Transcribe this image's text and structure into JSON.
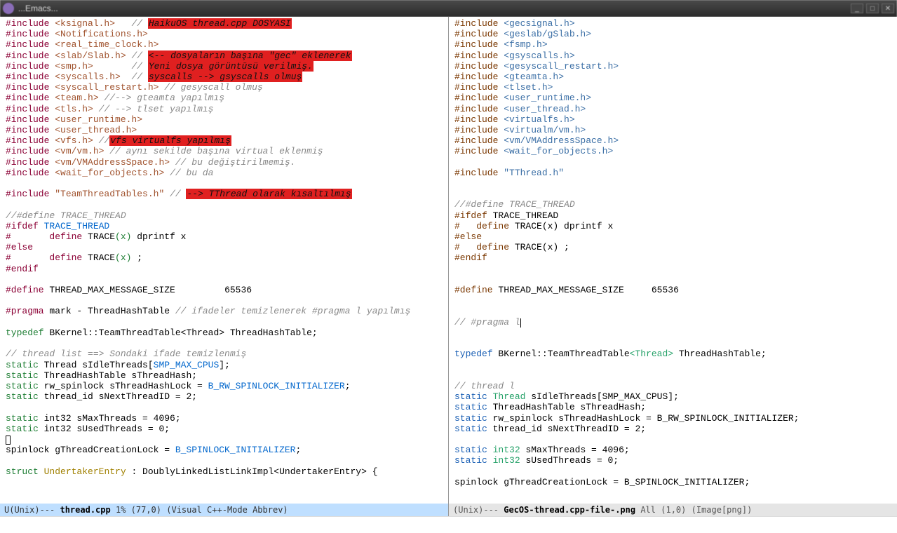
{
  "window": {
    "title": "...Emacs..."
  },
  "left": {
    "lines": [
      [
        [
          "kw-pp",
          "#include "
        ],
        [
          "kw-str",
          "<ksignal.h>"
        ],
        [
          "",
          "   "
        ],
        [
          "kw-cmt",
          "// "
        ],
        [
          "kw-hl",
          "HaikuOS thread.cpp DOSYASI"
        ]
      ],
      [
        [
          "kw-pp",
          "#include "
        ],
        [
          "kw-str",
          "<Notifications.h>"
        ]
      ],
      [
        [
          "kw-pp",
          "#include "
        ],
        [
          "kw-str",
          "<real_time_clock.h>"
        ]
      ],
      [
        [
          "kw-pp",
          "#include "
        ],
        [
          "kw-str",
          "<slab/Slab.h>"
        ],
        [
          "",
          " "
        ],
        [
          "kw-cmt",
          "// "
        ],
        [
          "kw-hl",
          "<-- dosyaların başına \"gec\" eklenerek"
        ]
      ],
      [
        [
          "kw-pp",
          "#include "
        ],
        [
          "kw-str",
          "<smp.h>"
        ],
        [
          "",
          "       "
        ],
        [
          "kw-cmt",
          "// "
        ],
        [
          "kw-hl",
          "Yeni dosya görüntüsü verilmiş."
        ]
      ],
      [
        [
          "kw-pp",
          "#include "
        ],
        [
          "kw-str",
          "<syscalls.h>"
        ],
        [
          "",
          "  "
        ],
        [
          "kw-cmt",
          "// "
        ],
        [
          "kw-hl",
          "syscalls --> gsyscalls olmuş"
        ]
      ],
      [
        [
          "kw-pp",
          "#include "
        ],
        [
          "kw-str",
          "<syscall_restart.h>"
        ],
        [
          "",
          " "
        ],
        [
          "kw-cmt",
          "// gesyscall olmuş"
        ]
      ],
      [
        [
          "kw-pp",
          "#include "
        ],
        [
          "kw-str",
          "<team.h>"
        ],
        [
          "",
          " "
        ],
        [
          "kw-cmt",
          "//--> gteamta yapılmış"
        ]
      ],
      [
        [
          "kw-pp",
          "#include "
        ],
        [
          "kw-str",
          "<tls.h>"
        ],
        [
          "",
          " "
        ],
        [
          "kw-cmt",
          "// --> tlset yapılmış"
        ]
      ],
      [
        [
          "kw-pp",
          "#include "
        ],
        [
          "kw-str",
          "<user_runtime.h>"
        ]
      ],
      [
        [
          "kw-pp",
          "#include "
        ],
        [
          "kw-str",
          "<user_thread.h>"
        ]
      ],
      [
        [
          "kw-pp",
          "#include "
        ],
        [
          "kw-str",
          "<vfs.h>"
        ],
        [
          "",
          " "
        ],
        [
          "kw-cmt",
          "//"
        ],
        [
          "kw-hl",
          "vfs virtualfs yapılmış"
        ]
      ],
      [
        [
          "kw-pp",
          "#include "
        ],
        [
          "kw-str",
          "<vm/vm.h>"
        ],
        [
          "",
          " "
        ],
        [
          "kw-cmt",
          "// aynı sekilde başına virtual eklenmiş"
        ]
      ],
      [
        [
          "kw-pp",
          "#include "
        ],
        [
          "kw-str",
          "<vm/VMAddressSpace.h>"
        ],
        [
          "",
          " "
        ],
        [
          "kw-cmt",
          "// bu değiştirilmemiş."
        ]
      ],
      [
        [
          "kw-pp",
          "#include "
        ],
        [
          "kw-str",
          "<wait_for_objects.h>"
        ],
        [
          "",
          " "
        ],
        [
          "kw-cmt",
          "// bu da"
        ]
      ],
      [
        [
          "",
          ""
        ]
      ],
      [
        [
          "kw-pp",
          "#include "
        ],
        [
          "kw-str",
          "\"TeamThreadTables.h\""
        ],
        [
          "",
          " "
        ],
        [
          "kw-cmt",
          "// "
        ],
        [
          "kw-hl",
          "--> TThread olarak kısaltılmış"
        ]
      ],
      [
        [
          "",
          ""
        ]
      ],
      [
        [
          "kw-cmt",
          "//#define TRACE_THREAD"
        ]
      ],
      [
        [
          "kw-pp",
          "#ifdef "
        ],
        [
          "kw-const",
          "TRACE_THREAD"
        ]
      ],
      [
        [
          "kw-pp",
          "#"
        ],
        [
          "",
          "       "
        ],
        [
          "kw-pp",
          "define "
        ],
        [
          "",
          "TRACE"
        ],
        [
          "kw-type",
          "(x)"
        ],
        [
          "",
          " dprintf x"
        ]
      ],
      [
        [
          "kw-pp",
          "#else"
        ]
      ],
      [
        [
          "kw-pp",
          "#"
        ],
        [
          "",
          "       "
        ],
        [
          "kw-pp",
          "define "
        ],
        [
          "",
          "TRACE"
        ],
        [
          "kw-type",
          "(x)"
        ],
        [
          "",
          " ;"
        ]
      ],
      [
        [
          "kw-pp",
          "#endif"
        ]
      ],
      [
        [
          "",
          ""
        ]
      ],
      [
        [
          "kw-pp",
          "#define "
        ],
        [
          "",
          "THREAD_MAX_MESSAGE_SIZE         65536"
        ]
      ],
      [
        [
          "",
          ""
        ]
      ],
      [
        [
          "kw-pp",
          "#pragma "
        ],
        [
          "",
          "mark - ThreadHashTable "
        ],
        [
          "kw-cmt",
          "// ifadeler temizlenerek #pragma l yapılmış"
        ]
      ],
      [
        [
          "",
          ""
        ]
      ],
      [
        [
          "kw-type",
          "typedef"
        ],
        [
          "",
          " BKernel::TeamThreadTable<Thread> ThreadHashTable;"
        ]
      ],
      [
        [
          "",
          ""
        ]
      ],
      [
        [
          "kw-cmt",
          "// thread list ==> Sondaki ifade temizlenmiş"
        ]
      ],
      [
        [
          "kw-type",
          "static"
        ],
        [
          "",
          " Thread sIdleThreads["
        ],
        [
          "kw-const",
          "SMP_MAX_CPUS"
        ],
        [
          "",
          "];"
        ]
      ],
      [
        [
          "kw-type",
          "static"
        ],
        [
          "",
          " ThreadHashTable sThreadHash;"
        ]
      ],
      [
        [
          "kw-type",
          "static"
        ],
        [
          "",
          " rw_spinlock sThreadHashLock = "
        ],
        [
          "kw-const",
          "B_RW_SPINLOCK_INITIALIZER"
        ],
        [
          "",
          ";"
        ]
      ],
      [
        [
          "kw-type",
          "static"
        ],
        [
          "",
          " thread_id sNextThreadID = 2;"
        ]
      ],
      [
        [
          "",
          ""
        ]
      ],
      [
        [
          "kw-type",
          "static"
        ],
        [
          "",
          " int32 sMaxThreads = 4096;"
        ]
      ],
      [
        [
          "kw-type",
          "static"
        ],
        [
          "",
          " int32 sUsedThreads = 0;"
        ]
      ],
      [
        [
          "box",
          "[]"
        ]
      ],
      [
        [
          "",
          "spinlock gThreadCreationLock = "
        ],
        [
          "kw-const",
          "B_SPINLOCK_INITIALIZER"
        ],
        [
          "",
          ";"
        ]
      ],
      [
        [
          "",
          ""
        ]
      ],
      [
        [
          "kw-type",
          "struct"
        ],
        [
          "",
          " "
        ],
        [
          "kw-ident",
          "UndertakerEntry"
        ],
        [
          "",
          " : DoublyLinkedListLinkImpl<UndertakerEntry> {"
        ]
      ]
    ],
    "modeline": {
      "prefix": "U(Unix)---  ",
      "buffer": "thread.cpp",
      "pos": "1%",
      "coords": "(77,0)",
      "mode": "(Visual C++-Mode Abbrev)"
    }
  },
  "right": {
    "lines": [
      [
        [
          "kw-pp",
          "#include "
        ],
        [
          "kw-str",
          "<gecsignal.h>"
        ]
      ],
      [
        [
          "kw-pp",
          "#include "
        ],
        [
          "kw-str",
          "<geslab/gSlab.h>"
        ]
      ],
      [
        [
          "kw-pp",
          "#include "
        ],
        [
          "kw-str",
          "<fsmp.h>"
        ]
      ],
      [
        [
          "kw-pp",
          "#include "
        ],
        [
          "kw-str",
          "<gsyscalls.h>"
        ]
      ],
      [
        [
          "kw-pp",
          "#include "
        ],
        [
          "kw-str",
          "<gesyscall_restart.h>"
        ]
      ],
      [
        [
          "kw-pp",
          "#include "
        ],
        [
          "kw-str",
          "<gteamta.h>"
        ]
      ],
      [
        [
          "kw-pp",
          "#include "
        ],
        [
          "kw-str",
          "<tlset.h>"
        ]
      ],
      [
        [
          "kw-pp",
          "#include "
        ],
        [
          "kw-str",
          "<user_runtime.h>"
        ]
      ],
      [
        [
          "kw-pp",
          "#include "
        ],
        [
          "kw-str",
          "<user_thread.h>"
        ]
      ],
      [
        [
          "kw-pp",
          "#include "
        ],
        [
          "kw-str",
          "<virtualfs.h>"
        ]
      ],
      [
        [
          "kw-pp",
          "#include "
        ],
        [
          "kw-str",
          "<virtualm/vm.h>"
        ]
      ],
      [
        [
          "kw-pp",
          "#include "
        ],
        [
          "kw-str",
          "<vm/VMAddressSpace.h>"
        ]
      ],
      [
        [
          "kw-pp",
          "#include "
        ],
        [
          "kw-str",
          "<wait_for_objects.h>"
        ]
      ],
      [
        [
          "",
          ""
        ]
      ],
      [
        [
          "kw-pp",
          "#include "
        ],
        [
          "kw-str",
          "\"TThread.h\""
        ]
      ],
      [
        [
          "",
          ""
        ]
      ],
      [
        [
          "",
          ""
        ]
      ],
      [
        [
          "kw-cmt",
          "//#define TRACE_THREAD"
        ]
      ],
      [
        [
          "kw-pp",
          "#ifdef "
        ],
        [
          "",
          "TRACE_THREAD"
        ]
      ],
      [
        [
          "kw-pp",
          "#   define "
        ],
        [
          "",
          "TRACE(x) dprintf x"
        ]
      ],
      [
        [
          "kw-pp",
          "#else"
        ]
      ],
      [
        [
          "kw-pp",
          "#   define "
        ],
        [
          "",
          "TRACE(x) ;"
        ]
      ],
      [
        [
          "kw-pp",
          "#endif"
        ]
      ],
      [
        [
          "",
          ""
        ]
      ],
      [
        [
          "",
          ""
        ]
      ],
      [
        [
          "kw-pp",
          "#define "
        ],
        [
          "",
          "THREAD_MAX_MESSAGE_SIZE     65536"
        ]
      ],
      [
        [
          "",
          ""
        ]
      ],
      [
        [
          "",
          ""
        ]
      ],
      [
        [
          "kw-cmt",
          "// #pragma l"
        ],
        [
          "cursor",
          ""
        ]
      ],
      [
        [
          "",
          ""
        ]
      ],
      [
        [
          "",
          ""
        ]
      ],
      [
        [
          "kw-type",
          "typedef"
        ],
        [
          "",
          " BKernel::TeamThreadTable"
        ],
        [
          "kw-ang",
          "<Thread>"
        ],
        [
          "",
          " ThreadHashTable;"
        ]
      ],
      [
        [
          "",
          ""
        ]
      ],
      [
        [
          "",
          ""
        ]
      ],
      [
        [
          "kw-cmt",
          "// thread l"
        ]
      ],
      [
        [
          "kw-type",
          "static"
        ],
        [
          "",
          " "
        ],
        [
          "kw-type2",
          "Thread"
        ],
        [
          "",
          " sIdleThreads[SMP_MAX_CPUS];"
        ]
      ],
      [
        [
          "kw-type",
          "static"
        ],
        [
          "",
          " ThreadHashTable sThreadHash;"
        ]
      ],
      [
        [
          "kw-type",
          "static"
        ],
        [
          "",
          " rw_spinlock sThreadHashLock = B_RW_SPINLOCK_INITIALIZER;"
        ]
      ],
      [
        [
          "kw-type",
          "static"
        ],
        [
          "",
          " thread_id sNextThreadID = 2;"
        ]
      ],
      [
        [
          "",
          ""
        ]
      ],
      [
        [
          "kw-type",
          "static"
        ],
        [
          "",
          " "
        ],
        [
          "kw-type2",
          "int32"
        ],
        [
          "",
          " sMaxThreads = 4096;"
        ]
      ],
      [
        [
          "kw-type",
          "static"
        ],
        [
          "",
          " "
        ],
        [
          "kw-type2",
          "int32"
        ],
        [
          "",
          " sUsedThreads = 0;"
        ]
      ],
      [
        [
          "",
          ""
        ]
      ],
      [
        [
          "",
          "spinlock gThreadCreationLock = B_SPINLOCK_INITIALIZER;"
        ]
      ],
      [
        [
          "",
          ""
        ]
      ],
      [
        [
          "",
          ""
        ]
      ],
      [
        [
          "kw-type",
          "struct"
        ],
        [
          "",
          " "
        ],
        [
          "kw-type2",
          "UndertakerEntry"
        ],
        [
          "",
          " : DoublyLinkedListLinkImpl"
        ],
        [
          "kw-ang",
          "<UndertakerEntry>"
        ],
        [
          "",
          " {"
        ]
      ]
    ],
    "modeline": {
      "prefix": " (Unix)---  ",
      "buffer": "GecOS-thread.cpp-file-.png",
      "pos": "All",
      "coords": "(1,0)",
      "mode": "(Image[png])"
    }
  }
}
